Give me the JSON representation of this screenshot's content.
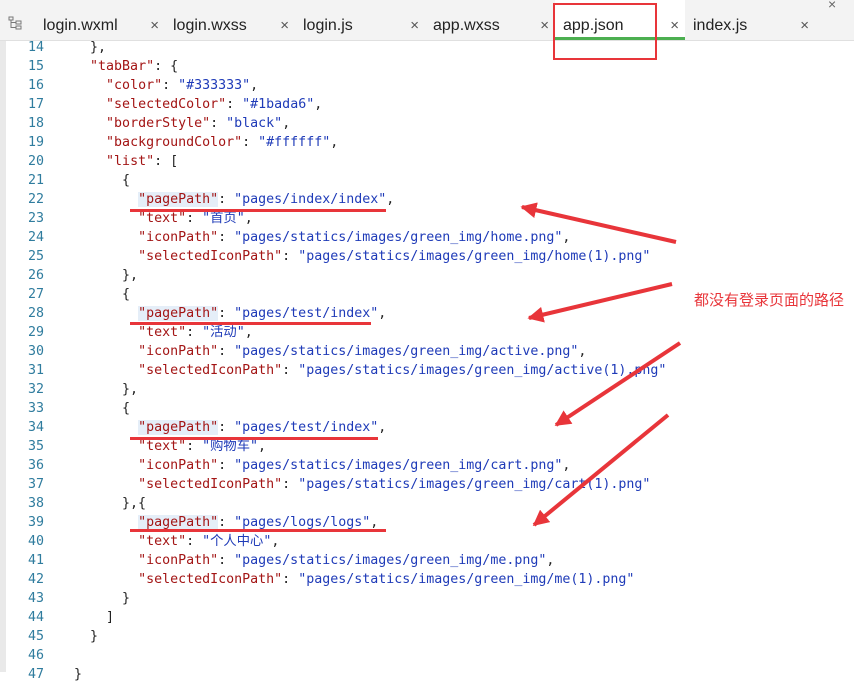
{
  "tabs": [
    {
      "label": "login.wxml",
      "active": false
    },
    {
      "label": "login.wxss",
      "active": false
    },
    {
      "label": "login.js",
      "active": false
    },
    {
      "label": "app.wxss",
      "active": false
    },
    {
      "label": "app.json",
      "active": true
    },
    {
      "label": "index.js",
      "active": false
    }
  ],
  "close_glyph": "×",
  "annotation": "都没有登录页面的路径",
  "colors": {
    "accent": "#e8353a",
    "active_tab": "#4caf50"
  },
  "code_lines": [
    {
      "n": "14",
      "segs": [
        {
          "t": "    },",
          "c": ""
        }
      ]
    },
    {
      "n": "15",
      "segs": [
        {
          "t": "    ",
          "c": ""
        },
        {
          "t": "\"tabBar\"",
          "c": "k"
        },
        {
          "t": ": {",
          "c": ""
        }
      ]
    },
    {
      "n": "16",
      "segs": [
        {
          "t": "      ",
          "c": ""
        },
        {
          "t": "\"color\"",
          "c": "k"
        },
        {
          "t": ": ",
          "c": ""
        },
        {
          "t": "\"#333333\"",
          "c": "v"
        },
        {
          "t": ",",
          "c": ""
        }
      ]
    },
    {
      "n": "17",
      "segs": [
        {
          "t": "      ",
          "c": ""
        },
        {
          "t": "\"selectedColor\"",
          "c": "k"
        },
        {
          "t": ": ",
          "c": ""
        },
        {
          "t": "\"#1bada6\"",
          "c": "v"
        },
        {
          "t": ",",
          "c": ""
        }
      ]
    },
    {
      "n": "18",
      "segs": [
        {
          "t": "      ",
          "c": ""
        },
        {
          "t": "\"borderStyle\"",
          "c": "k"
        },
        {
          "t": ": ",
          "c": ""
        },
        {
          "t": "\"black\"",
          "c": "v"
        },
        {
          "t": ",",
          "c": ""
        }
      ]
    },
    {
      "n": "19",
      "segs": [
        {
          "t": "      ",
          "c": ""
        },
        {
          "t": "\"backgroundColor\"",
          "c": "k"
        },
        {
          "t": ": ",
          "c": ""
        },
        {
          "t": "\"#ffffff\"",
          "c": "v"
        },
        {
          "t": ",",
          "c": ""
        }
      ]
    },
    {
      "n": "20",
      "segs": [
        {
          "t": "      ",
          "c": ""
        },
        {
          "t": "\"list\"",
          "c": "k"
        },
        {
          "t": ": [",
          "c": ""
        }
      ]
    },
    {
      "n": "21",
      "segs": [
        {
          "t": "        {",
          "c": ""
        }
      ]
    },
    {
      "n": "22",
      "segs": [
        {
          "t": "          ",
          "c": ""
        },
        {
          "t": "\"pagePath\"",
          "c": "kp"
        },
        {
          "t": ": ",
          "c": ""
        },
        {
          "t": "\"pages/index/index\"",
          "c": "v"
        },
        {
          "t": ",",
          "c": ""
        }
      ]
    },
    {
      "n": "23",
      "segs": [
        {
          "t": "          ",
          "c": ""
        },
        {
          "t": "\"text\"",
          "c": "k"
        },
        {
          "t": ": ",
          "c": ""
        },
        {
          "t": "\"首页\"",
          "c": "v"
        },
        {
          "t": ",",
          "c": ""
        }
      ]
    },
    {
      "n": "24",
      "segs": [
        {
          "t": "          ",
          "c": ""
        },
        {
          "t": "\"iconPath\"",
          "c": "k"
        },
        {
          "t": ": ",
          "c": ""
        },
        {
          "t": "\"pages/statics/images/green_img/home.png\"",
          "c": "v"
        },
        {
          "t": ",",
          "c": ""
        }
      ]
    },
    {
      "n": "25",
      "segs": [
        {
          "t": "          ",
          "c": ""
        },
        {
          "t": "\"selectedIconPath\"",
          "c": "k"
        },
        {
          "t": ": ",
          "c": ""
        },
        {
          "t": "\"pages/statics/images/green_img/home(1).png\"",
          "c": "v"
        }
      ]
    },
    {
      "n": "26",
      "segs": [
        {
          "t": "        },",
          "c": ""
        }
      ]
    },
    {
      "n": "27",
      "segs": [
        {
          "t": "        {",
          "c": ""
        }
      ]
    },
    {
      "n": "28",
      "segs": [
        {
          "t": "          ",
          "c": ""
        },
        {
          "t": "\"pagePath\"",
          "c": "kp"
        },
        {
          "t": ": ",
          "c": ""
        },
        {
          "t": "\"pages/test/index\"",
          "c": "v"
        },
        {
          "t": ",",
          "c": ""
        }
      ]
    },
    {
      "n": "29",
      "segs": [
        {
          "t": "          ",
          "c": ""
        },
        {
          "t": "\"text\"",
          "c": "k"
        },
        {
          "t": ": ",
          "c": ""
        },
        {
          "t": "\"活动\"",
          "c": "v"
        },
        {
          "t": ",",
          "c": ""
        }
      ]
    },
    {
      "n": "30",
      "segs": [
        {
          "t": "          ",
          "c": ""
        },
        {
          "t": "\"iconPath\"",
          "c": "k"
        },
        {
          "t": ": ",
          "c": ""
        },
        {
          "t": "\"pages/statics/images/green_img/active.png\"",
          "c": "v"
        },
        {
          "t": ",",
          "c": ""
        }
      ]
    },
    {
      "n": "31",
      "segs": [
        {
          "t": "          ",
          "c": ""
        },
        {
          "t": "\"selectedIconPath\"",
          "c": "k"
        },
        {
          "t": ": ",
          "c": ""
        },
        {
          "t": "\"pages/statics/images/green_img/active(1).png\"",
          "c": "v"
        }
      ]
    },
    {
      "n": "32",
      "segs": [
        {
          "t": "        },",
          "c": ""
        }
      ]
    },
    {
      "n": "33",
      "segs": [
        {
          "t": "        {",
          "c": ""
        }
      ]
    },
    {
      "n": "34",
      "segs": [
        {
          "t": "          ",
          "c": ""
        },
        {
          "t": "\"pagePath\"",
          "c": "kp"
        },
        {
          "t": ": ",
          "c": ""
        },
        {
          "t": "\"pages/test/index\"",
          "c": "v"
        },
        {
          "t": ",",
          "c": ""
        }
      ]
    },
    {
      "n": "35",
      "segs": [
        {
          "t": "          ",
          "c": ""
        },
        {
          "t": "\"text\"",
          "c": "k"
        },
        {
          "t": ": ",
          "c": ""
        },
        {
          "t": "\"购物车\"",
          "c": "v"
        },
        {
          "t": ",",
          "c": ""
        }
      ]
    },
    {
      "n": "36",
      "segs": [
        {
          "t": "          ",
          "c": ""
        },
        {
          "t": "\"iconPath\"",
          "c": "k"
        },
        {
          "t": ": ",
          "c": ""
        },
        {
          "t": "\"pages/statics/images/green_img/cart.png\"",
          "c": "v"
        },
        {
          "t": ",",
          "c": ""
        }
      ]
    },
    {
      "n": "37",
      "segs": [
        {
          "t": "          ",
          "c": ""
        },
        {
          "t": "\"selectedIconPath\"",
          "c": "k"
        },
        {
          "t": ": ",
          "c": ""
        },
        {
          "t": "\"pages/statics/images/green_img/cart(1).png\"",
          "c": "v"
        }
      ]
    },
    {
      "n": "38",
      "segs": [
        {
          "t": "        },{",
          "c": ""
        }
      ]
    },
    {
      "n": "39",
      "segs": [
        {
          "t": "          ",
          "c": ""
        },
        {
          "t": "\"pagePath\"",
          "c": "kp"
        },
        {
          "t": ": ",
          "c": ""
        },
        {
          "t": "\"pages/logs/logs\"",
          "c": "v"
        },
        {
          "t": ",",
          "c": ""
        }
      ]
    },
    {
      "n": "40",
      "segs": [
        {
          "t": "          ",
          "c": ""
        },
        {
          "t": "\"text\"",
          "c": "k"
        },
        {
          "t": ": ",
          "c": ""
        },
        {
          "t": "\"个人中心\"",
          "c": "v"
        },
        {
          "t": ",",
          "c": ""
        }
      ]
    },
    {
      "n": "41",
      "segs": [
        {
          "t": "          ",
          "c": ""
        },
        {
          "t": "\"iconPath\"",
          "c": "k"
        },
        {
          "t": ": ",
          "c": ""
        },
        {
          "t": "\"pages/statics/images/green_img/me.png\"",
          "c": "v"
        },
        {
          "t": ",",
          "c": ""
        }
      ]
    },
    {
      "n": "42",
      "segs": [
        {
          "t": "          ",
          "c": ""
        },
        {
          "t": "\"selectedIconPath\"",
          "c": "k"
        },
        {
          "t": ": ",
          "c": ""
        },
        {
          "t": "\"pages/statics/images/green_img/me(1).png\"",
          "c": "v"
        }
      ]
    },
    {
      "n": "43",
      "segs": [
        {
          "t": "        }",
          "c": ""
        }
      ]
    },
    {
      "n": "44",
      "segs": [
        {
          "t": "      ]",
          "c": ""
        }
      ]
    },
    {
      "n": "45",
      "segs": [
        {
          "t": "    }",
          "c": ""
        }
      ]
    },
    {
      "n": "46",
      "segs": [
        {
          "t": "",
          "c": ""
        }
      ]
    },
    {
      "n": "47",
      "segs": [
        {
          "t": "  }",
          "c": ""
        }
      ]
    }
  ]
}
